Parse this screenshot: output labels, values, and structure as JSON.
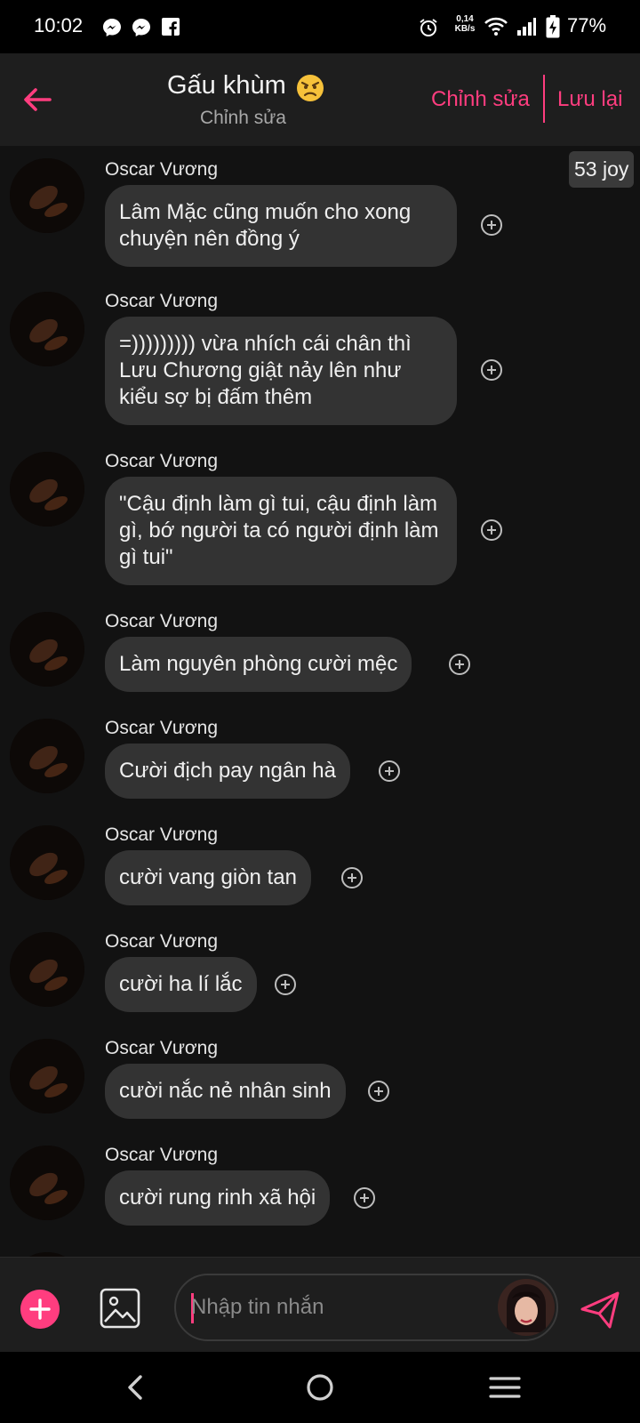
{
  "status_bar": {
    "time": "10:02",
    "net_speed_value": "0,14",
    "net_speed_unit": "KB/s",
    "battery": "77%"
  },
  "header": {
    "title": "Gấu khùm",
    "subtitle": "Chỉnh sửa",
    "edit_label": "Chỉnh sửa",
    "save_label": "Lưu lại"
  },
  "joy_badge": "53 joy",
  "messages": [
    {
      "sender": "Oscar Vương",
      "text": "Lâm Mặc cũng muốn cho xong chuyện nên đồng ý"
    },
    {
      "sender": "Oscar Vương",
      "text": "=))))))))) vừa nhích cái chân thì Lưu Chương giật nảy lên như kiểu sợ bị đấm thêm"
    },
    {
      "sender": "Oscar Vương",
      "text": "\"Cậu định làm gì tui, cậu định làm gì, bớ người ta có người định làm gì tui\""
    },
    {
      "sender": "Oscar Vương",
      "text": "Làm nguyên phòng cười mệc"
    },
    {
      "sender": "Oscar Vương",
      "text": "Cười địch pay ngân hà"
    },
    {
      "sender": "Oscar Vương",
      "text": "cười vang giòn tan"
    },
    {
      "sender": "Oscar Vương",
      "text": "cười ha lí lắc"
    },
    {
      "sender": "Oscar Vương",
      "text": "cười nắc nẻ nhân sinh"
    },
    {
      "sender": "Oscar Vương",
      "text": "cười rung rinh xã hội"
    }
  ],
  "composer": {
    "placeholder": "Nhập tin nhắn"
  },
  "colors": {
    "accent": "#ff3d7f",
    "bubble": "#333333",
    "background": "#121212",
    "header": "#1e1e1e"
  },
  "icons": {
    "back": "back-arrow-icon",
    "add_reaction": "add-circle-icon",
    "composer_add": "plus-icon",
    "gallery": "image-icon",
    "send": "send-icon"
  }
}
